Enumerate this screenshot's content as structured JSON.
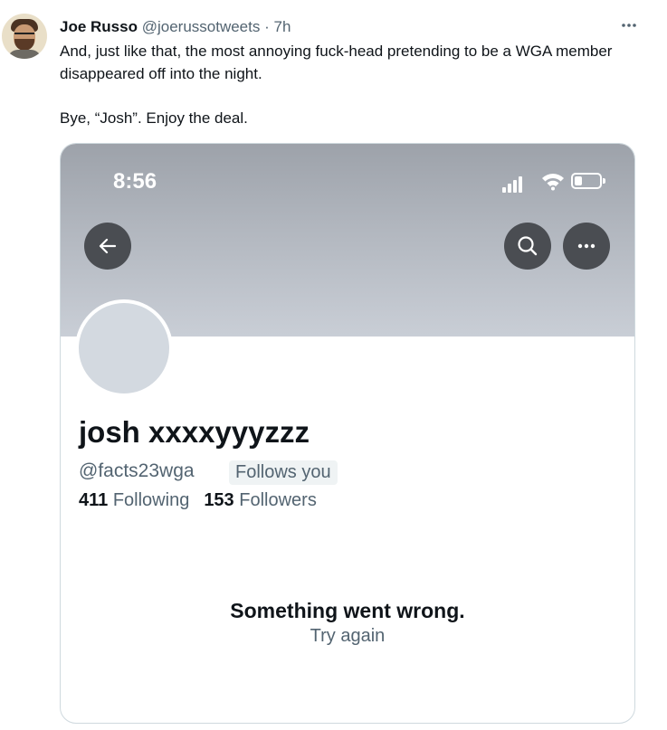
{
  "tweet": {
    "author": {
      "display_name": "Joe Russo",
      "handle": "@joerussotweets",
      "separator": "·",
      "time": "7h"
    },
    "more_icon": "more-horizontal-icon",
    "text_line1": "And, just like that, the most annoying fuck-head pretending to be a WGA member disappeared off into the night.",
    "text_line2": "Bye, “Josh”. Enjoy the deal."
  },
  "embedded_screenshot": {
    "status_bar": {
      "time": "8:56",
      "icons": [
        "signal-icon",
        "wifi-icon",
        "battery-icon"
      ]
    },
    "buttons": {
      "back_icon": "arrow-left-icon",
      "search_icon": "search-icon",
      "menu_icon": "more-horizontal-icon"
    },
    "profile": {
      "name": "josh xxxxyyyzzz",
      "handle": "@facts23wga",
      "follows_you": "Follows you",
      "following_count": "411",
      "following_label": "Following",
      "followers_count": "153",
      "followers_label": "Followers"
    },
    "error": {
      "title": "Something went wrong.",
      "retry": "Try again"
    }
  },
  "colors": {
    "text_primary": "#0f1419",
    "text_secondary": "#536471",
    "banner_top": "#9da2aa",
    "banner_bottom": "#c9ced6",
    "overlay_button": "#4a4d52"
  }
}
